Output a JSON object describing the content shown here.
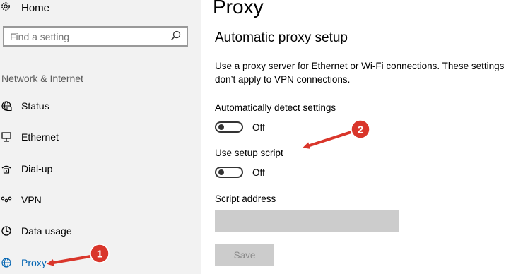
{
  "sidebar": {
    "home_label": "Home",
    "search_placeholder": "Find a setting",
    "section_heading": "Network & Internet",
    "items": [
      {
        "label": "Status",
        "icon": "globe-status-icon"
      },
      {
        "label": "Ethernet",
        "icon": "ethernet-icon"
      },
      {
        "label": "Dial-up",
        "icon": "dial-up-icon"
      },
      {
        "label": "VPN",
        "icon": "vpn-icon"
      },
      {
        "label": "Data usage",
        "icon": "data-usage-icon"
      },
      {
        "label": "Proxy",
        "icon": "globe-icon"
      }
    ],
    "active_item": "Proxy"
  },
  "main": {
    "title": "Proxy",
    "subtitle": "Automatic proxy setup",
    "description": "Use a proxy server for Ethernet or Wi-Fi connections. These settings don’t apply to VPN connections.",
    "auto_detect": {
      "label": "Automatically detect settings",
      "state": "Off"
    },
    "setup_script": {
      "label": "Use setup script",
      "state": "Off"
    },
    "script_address_label": "Script address",
    "script_address_value": "",
    "save_label": "Save"
  },
  "annotations": {
    "marker_1": "1",
    "marker_2": "2",
    "color": "#d9362b"
  },
  "colors": {
    "sidebar_bg": "#f2f2f2",
    "accent": "#0063b1",
    "disabled": "#cccccc"
  }
}
